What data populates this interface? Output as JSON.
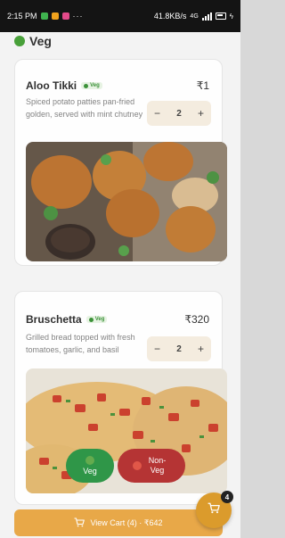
{
  "status_bar": {
    "time": "2:15 PM",
    "dots": "···",
    "network": "41.8KB/s",
    "sim_label": "4G"
  },
  "category": {
    "title": "Veg",
    "color": "#3a9a2a"
  },
  "items": [
    {
      "name": "Aloo Tikki",
      "badge": "Veg",
      "price": "₹1",
      "description": "Spiced potato patties pan-fried golden, served with mint chutney",
      "quantity": "2",
      "minus": "−",
      "plus": "+"
    },
    {
      "name": "Bruschetta",
      "badge": "Veg",
      "price": "₹320",
      "description": "Grilled bread topped with fresh tomatoes, garlic, and basil",
      "quantity": "2",
      "minus": "−",
      "plus": "+"
    }
  ],
  "filters": {
    "veg_label": "Veg",
    "nonveg_label": "Non-Veg"
  },
  "cart": {
    "badge_count": "4",
    "view_cart_label": "View Cart (4) · ₹642"
  },
  "colors": {
    "accent": "#e8a23a",
    "veg_green": "#1f8f3a",
    "nonveg_red": "#b02424"
  }
}
